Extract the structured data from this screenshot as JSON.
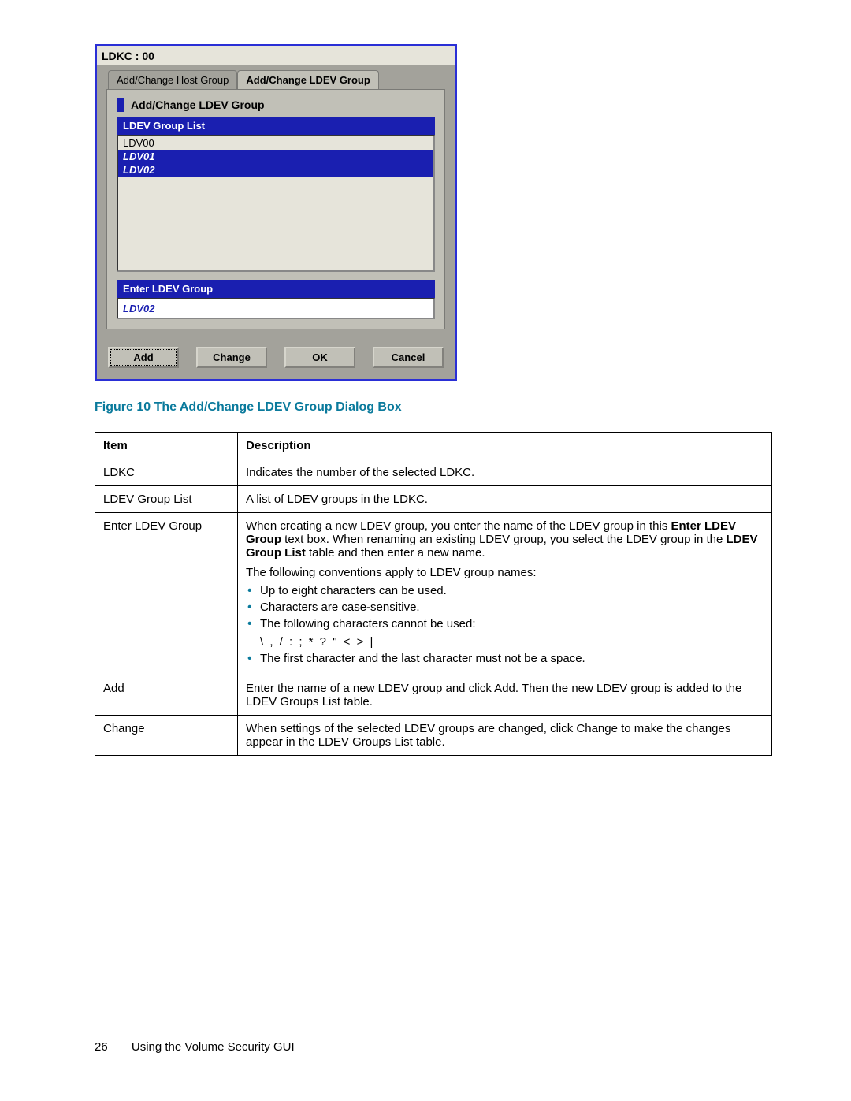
{
  "dialog": {
    "header": "LDKC : 00",
    "tabs": [
      "Add/Change Host Group",
      "Add/Change LDEV Group"
    ],
    "title": "Add/Change LDEV Group",
    "list_header": "LDEV Group List",
    "list_items": [
      {
        "label": "LDV00",
        "selected": false,
        "italic": false
      },
      {
        "label": "LDV01",
        "selected": true,
        "italic": true
      },
      {
        "label": "LDV02",
        "selected": true,
        "italic": true
      }
    ],
    "enter_header": "Enter LDEV Group",
    "enter_value": "LDV02",
    "buttons": {
      "add": "Add",
      "change": "Change",
      "ok": "OK",
      "cancel": "Cancel"
    }
  },
  "caption": "Figure 10 The Add/Change LDEV Group Dialog Box",
  "table": {
    "head_item": "Item",
    "head_desc": "Description",
    "rows": {
      "ldkc": {
        "item": "LDKC",
        "desc": "Indicates the number of the selected LDKC."
      },
      "list": {
        "item": "LDEV Group List",
        "desc": "A list of LDEV groups in the LDKC."
      },
      "enter": {
        "item": "Enter LDEV Group",
        "p1a": "When creating a new LDEV group, you enter the name of the LDEV group in this ",
        "p1b": "Enter LDEV Group",
        "p1c": " text box. When renaming an existing LDEV group, you select the LDEV group in the ",
        "p1d": "LDEV Group List",
        "p1e": " table and then enter a new name.",
        "p2": "The following conventions apply to LDEV group names:",
        "b1": "Up to eight characters can be used.",
        "b2": "Characters are case-sensitive.",
        "b3": "The following characters cannot be used:",
        "forbidden": "\\ , / : ; * ? \" < > |",
        "b4": "The first character and the last character must not be a space."
      },
      "add": {
        "item": "Add",
        "desc": "Enter the name of a new LDEV group and click Add. Then the new LDEV group is added to the LDEV Groups List table."
      },
      "change": {
        "item": "Change",
        "desc": "When settings of the selected LDEV groups are changed, click Change to make the changes appear in the LDEV Groups List table."
      }
    }
  },
  "footer": {
    "page": "26",
    "section": "Using the Volume Security GUI"
  }
}
